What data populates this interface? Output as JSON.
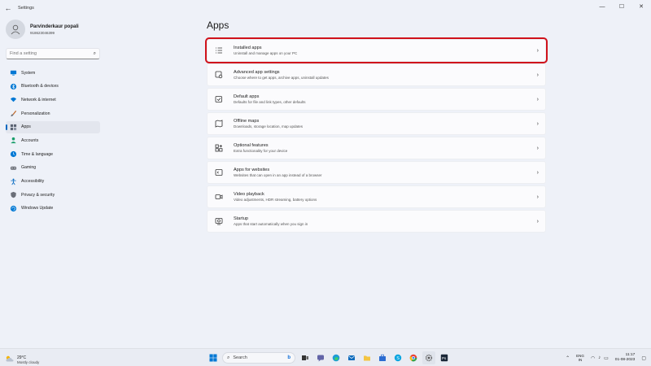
{
  "window": {
    "title": "Settings",
    "controls": [
      "—",
      "☐",
      "✕"
    ]
  },
  "profile": {
    "name": "Parvinderkaur popali",
    "account": "918623046399"
  },
  "search": {
    "placeholder": "Find a setting"
  },
  "nav": {
    "items": [
      {
        "label": "System",
        "icon": "monitor-icon",
        "color": "#0078d4"
      },
      {
        "label": "Bluetooth & devices",
        "icon": "bluetooth-icon",
        "color": "#0078d4"
      },
      {
        "label": "Network & internet",
        "icon": "wifi-icon",
        "color": "#0078d4"
      },
      {
        "label": "Personalization",
        "icon": "brush-icon",
        "color": "#c26b2d"
      },
      {
        "label": "Apps",
        "icon": "apps-icon",
        "color": "#5b6373"
      },
      {
        "label": "Accounts",
        "icon": "person-icon",
        "color": "#1a9e6b"
      },
      {
        "label": "Time & language",
        "icon": "globe-clock-icon",
        "color": "#0078d4"
      },
      {
        "label": "Gaming",
        "icon": "gamepad-icon",
        "color": "#6b6f78"
      },
      {
        "label": "Accessibility",
        "icon": "accessibility-icon",
        "color": "#0067c0"
      },
      {
        "label": "Privacy & security",
        "icon": "shield-icon",
        "color": "#6b6f78"
      },
      {
        "label": "Windows Update",
        "icon": "update-icon",
        "color": "#0078d4"
      }
    ],
    "active_index": 4
  },
  "main": {
    "title": "Apps",
    "cards": [
      {
        "title": "Installed apps",
        "subtitle": "Uninstall and manage apps on your PC",
        "icon": "list-icon"
      },
      {
        "title": "Advanced app settings",
        "subtitle": "Choose where to get apps, archive apps, uninstall updates",
        "icon": "app-settings-icon"
      },
      {
        "title": "Default apps",
        "subtitle": "Defaults for file and link types, other defaults",
        "icon": "default-apps-icon"
      },
      {
        "title": "Offline maps",
        "subtitle": "Downloads, storage location, map updates",
        "icon": "map-icon"
      },
      {
        "title": "Optional features",
        "subtitle": "Extra functionality for your device",
        "icon": "features-icon"
      },
      {
        "title": "Apps for websites",
        "subtitle": "Websites that can open in an app instead of a browser",
        "icon": "web-app-icon"
      },
      {
        "title": "Video playback",
        "subtitle": "Video adjustments, HDR streaming, battery options",
        "icon": "video-icon"
      },
      {
        "title": "Startup",
        "subtitle": "Apps that start automatically when you sign in",
        "icon": "startup-icon"
      }
    ],
    "highlight_index": 0,
    "highlight_color": "#d0121b"
  },
  "taskbar": {
    "weather_temp": "29°C",
    "weather_cond": "Mostly cloudy",
    "search_label": "Search",
    "lang_line1": "ENG",
    "lang_line2": "IN",
    "time": "11:17",
    "date": "01-08-2023"
  }
}
